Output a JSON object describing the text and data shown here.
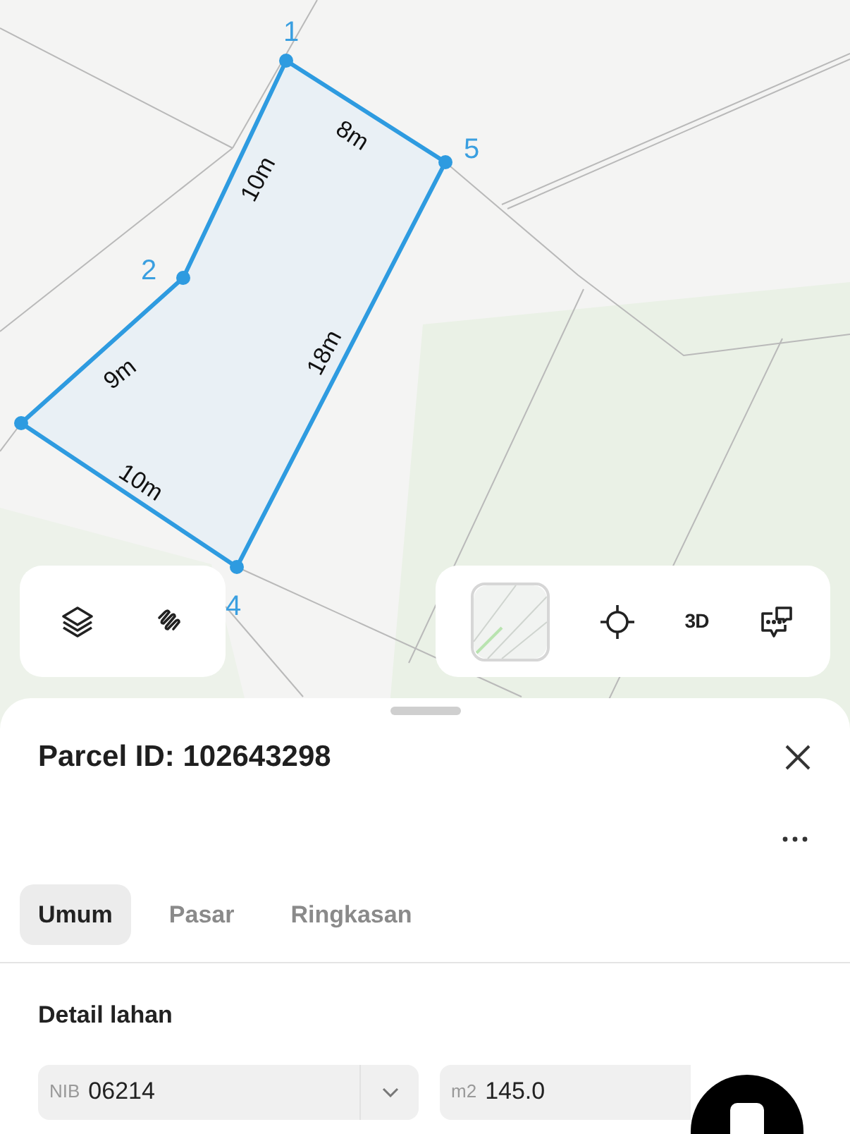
{
  "map": {
    "vertex_labels": [
      "1",
      "2",
      "4",
      "5"
    ],
    "edge_labels": [
      "8m",
      "10m",
      "18m",
      "9m",
      "10m"
    ]
  },
  "left_tools": [
    {
      "kind": "layers"
    },
    {
      "kind": "measure"
    }
  ],
  "right_tools": [
    {
      "kind": "basemap",
      "selected": true
    },
    {
      "kind": "locate"
    },
    {
      "kind": "text",
      "label": "3D"
    },
    {
      "kind": "chat"
    }
  ],
  "sheet": {
    "title": "Parcel ID: 102643298",
    "tabs": [
      {
        "label": "Umum",
        "selected": true
      },
      {
        "label": "Pasar",
        "selected": false
      },
      {
        "label": "Ringkasan",
        "selected": false
      }
    ],
    "section": "Detail lahan",
    "fields": [
      {
        "prefix": "NIB",
        "value": "06214"
      },
      {
        "prefix": "m2",
        "value": "145.0"
      }
    ]
  }
}
